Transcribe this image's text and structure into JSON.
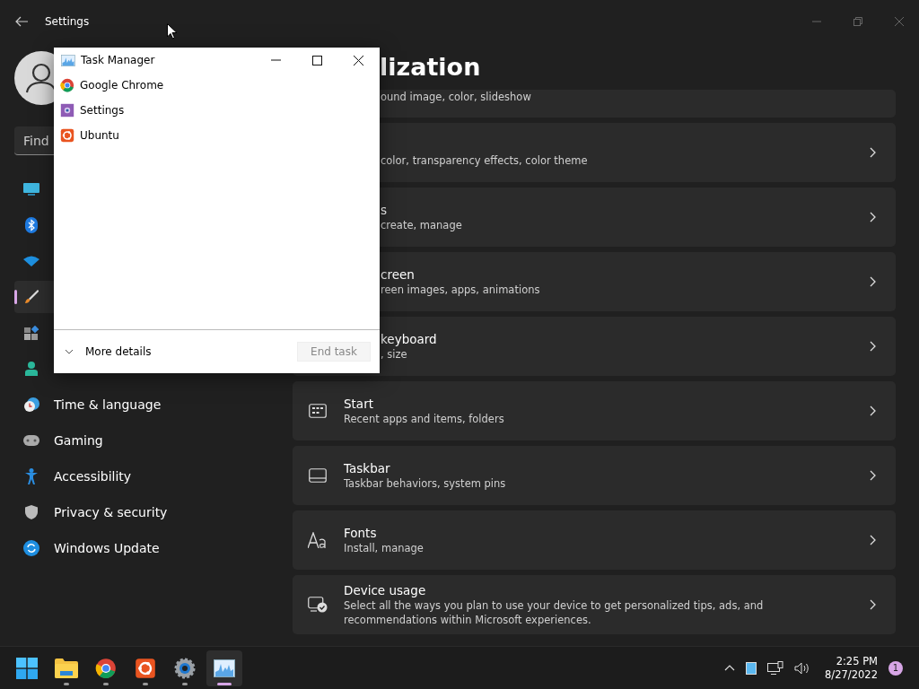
{
  "window": {
    "title": "Settings"
  },
  "sidebar": {
    "search": {
      "placeholder": "Find"
    },
    "items": [
      {
        "kind": "display",
        "selected": false
      },
      {
        "kind": "bluetooth",
        "selected": false
      },
      {
        "kind": "network",
        "selected": false
      },
      {
        "kind": "brush",
        "selected": true
      },
      {
        "kind": "apps",
        "selected": false
      },
      {
        "kind": "accounts",
        "selected": false
      },
      {
        "kind": "time",
        "label": "Time & language",
        "selected": false
      },
      {
        "kind": "gaming",
        "label": "Gaming",
        "selected": false
      },
      {
        "kind": "accessibility",
        "label": "Accessibility",
        "selected": false
      },
      {
        "kind": "privacy",
        "label": "Privacy & security",
        "selected": false
      },
      {
        "kind": "update",
        "label": "Windows Update",
        "selected": false
      }
    ]
  },
  "page": {
    "title": "lization",
    "cards": [
      {
        "description": "ound image, color, slideshow"
      },
      {
        "description": "color, transparency effects, color theme"
      },
      {
        "title": "s",
        "description": "create, manage"
      },
      {
        "title": "creen",
        "description": "reen images, apps, animations"
      },
      {
        "title": "keyboard",
        "description": ", size"
      },
      {
        "kind": "start",
        "title": "Start",
        "description": "Recent apps and items, folders"
      },
      {
        "kind": "taskbar",
        "title": "Taskbar",
        "description": "Taskbar behaviors, system pins"
      },
      {
        "kind": "fonts",
        "title": "Fonts",
        "description": "Install, manage"
      },
      {
        "kind": "device",
        "title": "Device usage",
        "description": "Select all the ways you plan to use your device to get personalized tips, ads, and recommendations within Microsoft experiences."
      }
    ]
  },
  "task_manager": {
    "title": "Task Manager",
    "apps": [
      {
        "kind": "chrome",
        "name": "Google Chrome"
      },
      {
        "kind": "settings",
        "name": "Settings"
      },
      {
        "kind": "ubuntu",
        "name": "Ubuntu"
      }
    ],
    "more_details": "More details",
    "end_task": {
      "label": "End task",
      "disabled": true
    }
  },
  "taskbar": {
    "apps": [
      {
        "kind": "start",
        "running": false,
        "selected": false
      },
      {
        "kind": "explorer",
        "running": true,
        "selected": false
      },
      {
        "kind": "chrome",
        "running": true,
        "selected": false
      },
      {
        "kind": "ubuntu",
        "running": true,
        "selected": false
      },
      {
        "kind": "settings",
        "running": true,
        "selected": false
      },
      {
        "kind": "taskmanager",
        "running": true,
        "selected": true
      }
    ],
    "time": "2:25 PM",
    "date": "8/27/2022",
    "notifications": "1"
  }
}
